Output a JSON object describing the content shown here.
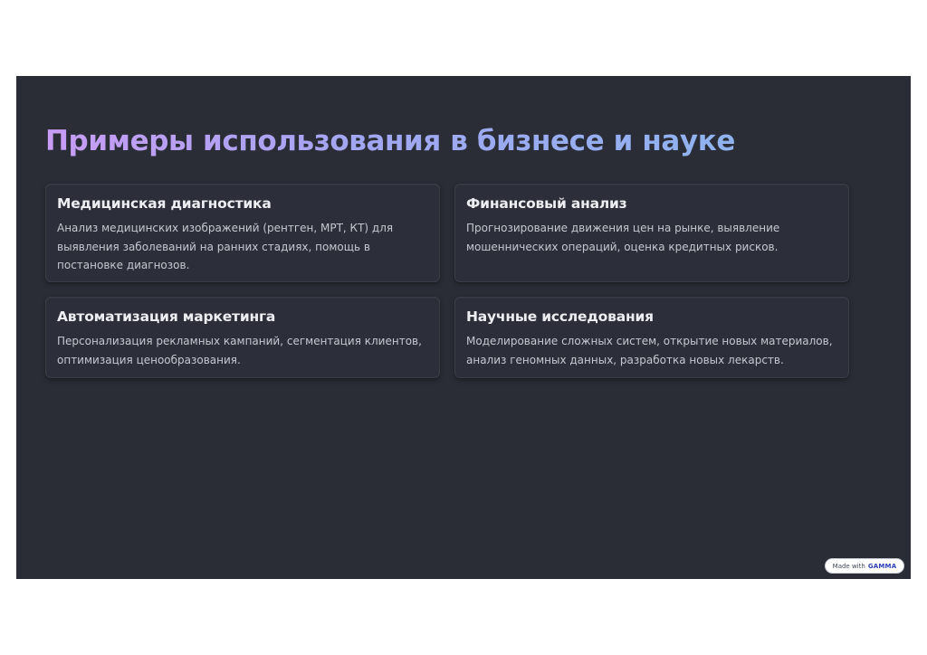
{
  "slide": {
    "title": "Примеры использования в бизнесе и науке"
  },
  "cards": [
    {
      "title": "Медицинская диагностика",
      "text": "Анализ медицинских изображений (рентген, МРТ, КТ) для выявления заболеваний на ранних стадиях, помощь в постановке диагнозов."
    },
    {
      "title": "Финансовый анализ",
      "text": "Прогнозирование движения цен на рынке, выявление мошеннических операций, оценка кредитных рисков."
    },
    {
      "title": "Автоматизация маркетинга",
      "text": "Персонализация рекламных кампаний, сегментация клиентов, оптимизация ценообразования."
    },
    {
      "title": "Научные исследования",
      "text": "Моделирование сложных систем, открытие новых материалов, анализ геномных данных, разработка новых лекарств."
    }
  ],
  "badge": {
    "prefix": "Made with",
    "brand": "GAMMA"
  },
  "colors": {
    "slide_background": "#2a2d36",
    "card_background": "#2c2f39",
    "title_gradient_start": "#c89cf4",
    "title_gradient_end": "#8fb3ef"
  }
}
